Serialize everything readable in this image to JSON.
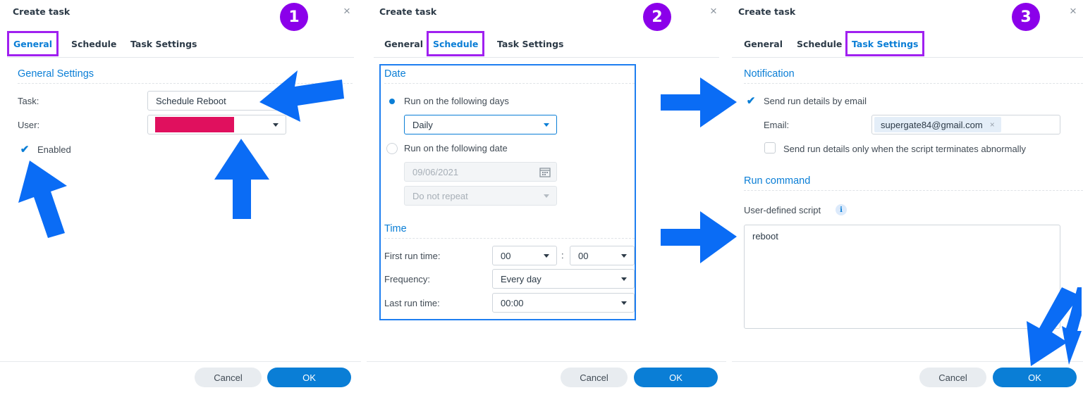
{
  "dialog_title": "Create task",
  "close_glyph": "×",
  "steps": [
    "1",
    "2",
    "3"
  ],
  "tabs": {
    "general": "General",
    "schedule": "Schedule",
    "task_settings": "Task Settings"
  },
  "general": {
    "section": "General Settings",
    "task_label": "Task:",
    "task_value": "Schedule Reboot",
    "user_label": "User:",
    "user_value_redacted_color": "#e0105e",
    "enabled_label": "Enabled",
    "enabled_checked": true
  },
  "schedule": {
    "date_section": "Date",
    "radio_days_label": "Run on the following days",
    "days_value": "Daily",
    "radio_date_label": "Run on the following date",
    "date_value": "09/06/2021",
    "repeat_value": "Do not repeat",
    "time_section": "Time",
    "first_run_label": "First run time:",
    "first_run_hour": "00",
    "time_separator": ":",
    "first_run_minute": "00",
    "frequency_label": "Frequency:",
    "frequency_value": "Every day",
    "last_run_label": "Last run time:",
    "last_run_value": "00:00"
  },
  "task_settings": {
    "notification_section": "Notification",
    "send_email_label": "Send run details by email",
    "send_email_checked": true,
    "email_label": "Email:",
    "email_value": "supergate84@gmail.com",
    "tag_remove_glyph": "×",
    "abnormal_label": "Send run details only when the script terminates abnormally",
    "run_command_section": "Run command",
    "script_label": "User-defined script",
    "info_glyph": "i",
    "script_value": "reboot"
  },
  "buttons": {
    "cancel": "Cancel",
    "ok": "OK"
  },
  "colors": {
    "accent": "#0a7ed6",
    "highlight": "#a020f0",
    "step_badge": "#8b00ea",
    "arrow": "#0a6cf5"
  }
}
